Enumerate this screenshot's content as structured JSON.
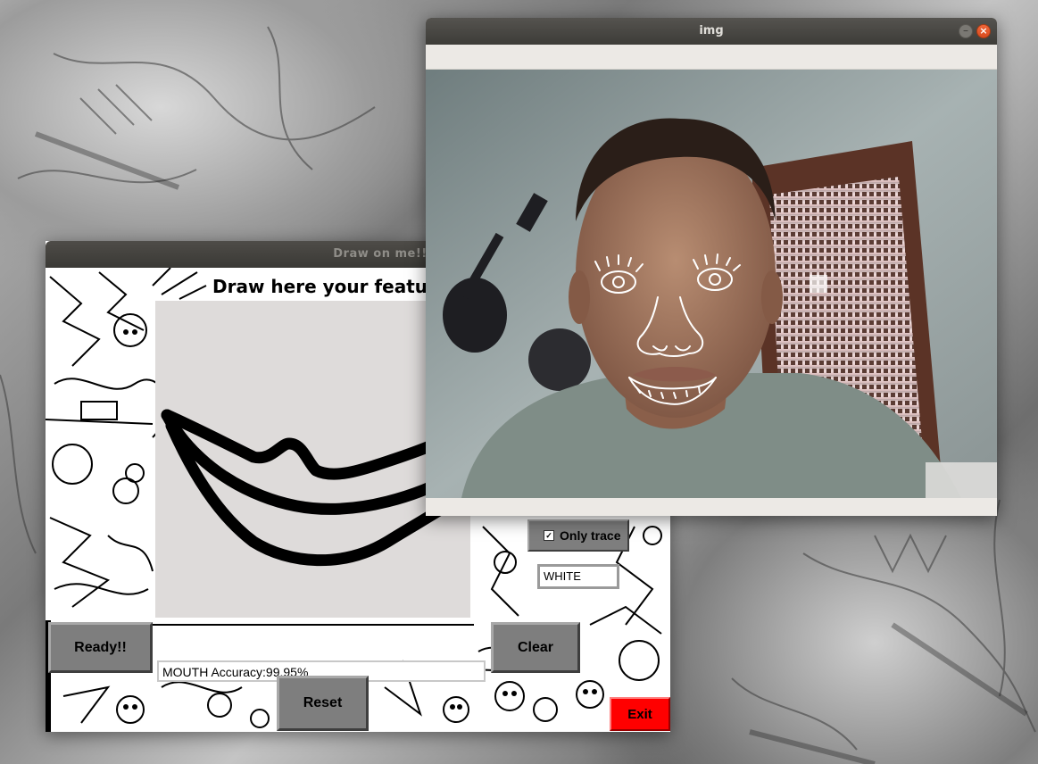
{
  "draw_window": {
    "title": "Draw on me!!",
    "heading": "Draw here your feature!",
    "ready_label": "Ready!!",
    "clear_label": "Clear",
    "reset_label": "Reset",
    "exit_label": "Exit",
    "accuracy_text": "MOUTH Accuracy:99.95%",
    "only_trace_label": "Only trace",
    "only_trace_checked": true,
    "color_value": "WHITE"
  },
  "camera_window": {
    "title": "img"
  },
  "colors": {
    "exit_red": "#ff0000",
    "button_gray": "#7e7e7e",
    "canvas_bg": "#dedbda",
    "titlebar": "#3c3b37",
    "close_orange": "#e4552a"
  },
  "icons": [
    "minimize-icon",
    "close-icon",
    "checkbox-icon"
  ]
}
